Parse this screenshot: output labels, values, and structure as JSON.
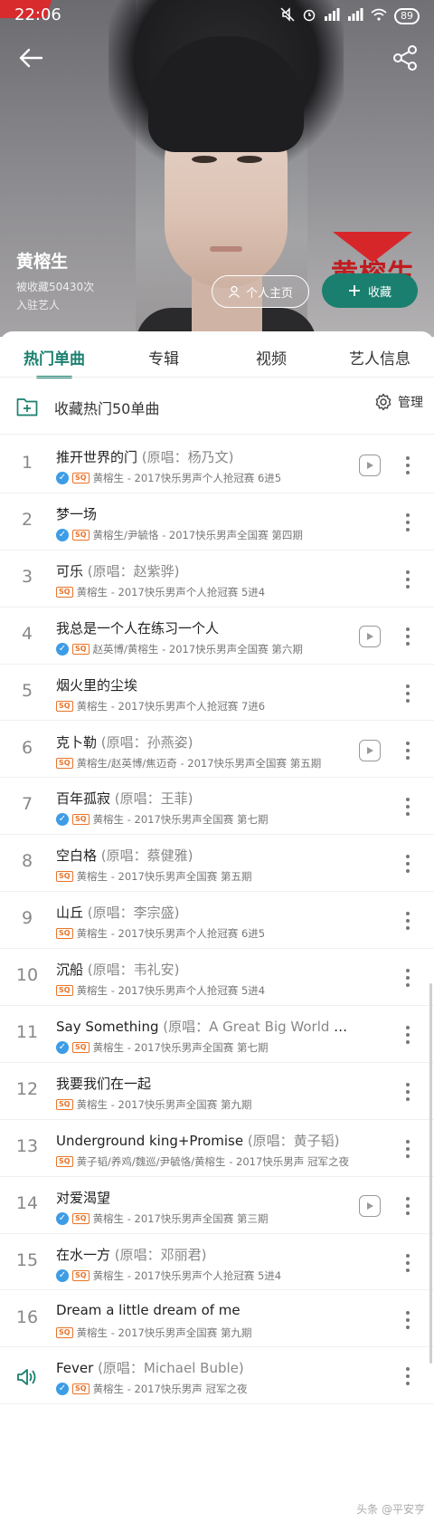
{
  "status_bar": {
    "time": "22:06",
    "battery": "89"
  },
  "artist": {
    "name": "黄榕生",
    "fav_count": "被收藏50430次",
    "tag": "入驻艺人",
    "brand_text": "黄榕生"
  },
  "header_buttons": {
    "home": "个人主页",
    "collect": "收藏"
  },
  "tabs": [
    "热门单曲",
    "专辑",
    "视频",
    "艺人信息"
  ],
  "collect_bar": {
    "label": "收藏热门50单曲",
    "manage": "管理"
  },
  "songs": [
    {
      "num": "1",
      "title": "推开世界的门",
      "orig": " (原唱：杨乃文)",
      "check": true,
      "sq": true,
      "meta": "黄榕生 - 2017快乐男声个人抢冠赛 6进5",
      "mv": true
    },
    {
      "num": "2",
      "title": "梦一场",
      "orig": "",
      "check": true,
      "sq": true,
      "meta": "黄榕生/尹毓恪 - 2017快乐男声全国赛 第四期",
      "mv": false
    },
    {
      "num": "3",
      "title": "可乐",
      "orig": " (原唱：赵紫骅)",
      "check": false,
      "sq": true,
      "meta": "黄榕生 - 2017快乐男声个人抢冠赛 5进4",
      "mv": false
    },
    {
      "num": "4",
      "title": "我总是一个人在练习一个人",
      "orig": "",
      "check": true,
      "sq": true,
      "meta": "赵英博/黄榕生 - 2017快乐男声全国赛 第六期",
      "mv": true
    },
    {
      "num": "5",
      "title": "烟火里的尘埃",
      "orig": "",
      "check": false,
      "sq": true,
      "meta": "黄榕生 - 2017快乐男声个人抢冠赛 7进6",
      "mv": false
    },
    {
      "num": "6",
      "title": "克卜勒",
      "orig": " (原唱：孙燕姿)",
      "check": false,
      "sq": true,
      "meta": "黄榕生/赵英博/焦迈奇 - 2017快乐男声全国赛 第五期",
      "mv": true
    },
    {
      "num": "7",
      "title": "百年孤寂",
      "orig": " (原唱：王菲)",
      "check": true,
      "sq": true,
      "meta": "黄榕生 - 2017快乐男声全国赛 第七期",
      "mv": false
    },
    {
      "num": "8",
      "title": "空白格",
      "orig": " (原唱：蔡健雅)",
      "check": false,
      "sq": true,
      "meta": "黄榕生 - 2017快乐男声全国赛 第五期",
      "mv": false
    },
    {
      "num": "9",
      "title": "山丘",
      "orig": " (原唱：李宗盛)",
      "check": false,
      "sq": true,
      "meta": "黄榕生 - 2017快乐男声个人抢冠赛 6进5",
      "mv": false
    },
    {
      "num": "10",
      "title": "沉船",
      "orig": " (原唱：韦礼安)",
      "check": false,
      "sq": true,
      "meta": "黄榕生 - 2017快乐男声个人抢冠赛 5进4",
      "mv": false
    },
    {
      "num": "11",
      "title": "Say Something",
      "orig": " (原唱：A Great Big World & Christina...",
      "check": true,
      "sq": true,
      "meta": "黄榕生 - 2017快乐男声全国赛 第七期",
      "mv": false
    },
    {
      "num": "12",
      "title": "我要我们在一起",
      "orig": "",
      "check": false,
      "sq": true,
      "meta": "黄榕生 - 2017快乐男声全国赛 第九期",
      "mv": false
    },
    {
      "num": "13",
      "title": "Underground king+Promise",
      "orig": " (原唱：黄子韬)",
      "check": false,
      "sq": true,
      "meta": "黄子韬/养鸡/魏巡/尹毓恪/黄榕生 - 2017快乐男声 冠军之夜",
      "mv": false
    },
    {
      "num": "14",
      "title": "对爱渴望",
      "orig": "",
      "check": true,
      "sq": true,
      "meta": "黄榕生 - 2017快乐男声全国赛 第三期",
      "mv": true
    },
    {
      "num": "15",
      "title": "在水一方",
      "orig": " (原唱：邓丽君)",
      "check": true,
      "sq": true,
      "meta": "黄榕生 - 2017快乐男声个人抢冠赛 5进4",
      "mv": false
    },
    {
      "num": "16",
      "title": "Dream a little dream of me",
      "orig": "",
      "check": false,
      "sq": true,
      "meta": "黄榕生 - 2017快乐男声全国赛 第九期",
      "mv": false
    },
    {
      "num": "",
      "title": "Fever",
      "orig": " (原唱：Michael Buble)",
      "check": true,
      "sq": true,
      "meta": "黄榕生 - 2017快乐男声 冠军之夜",
      "mv": false,
      "playing": true
    }
  ],
  "sq_label": "SQ",
  "watermark": "头条 @平安亨"
}
